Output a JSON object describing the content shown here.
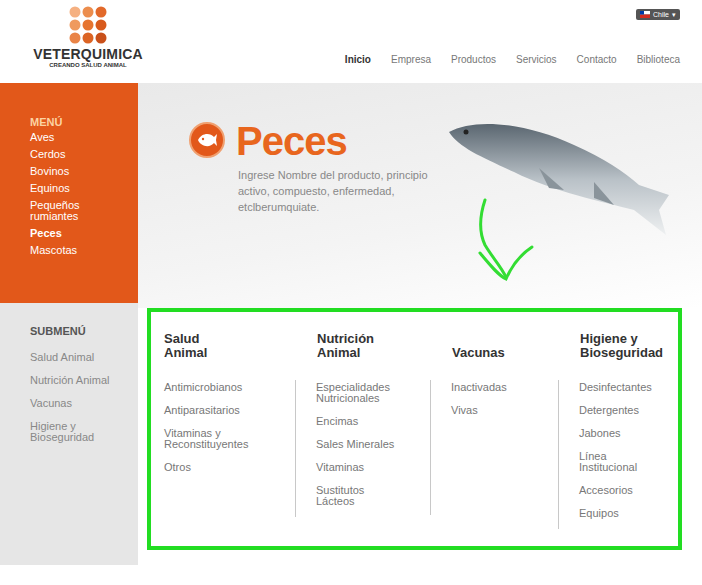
{
  "logo": {
    "name": "VETERQUIMICA",
    "tagline": "CREANDO SALUD ANIMAL"
  },
  "country": {
    "label": "Chile",
    "caret": "▾"
  },
  "nav": [
    {
      "label": "Inicio",
      "selected": true
    },
    {
      "label": "Empresa",
      "selected": false
    },
    {
      "label": "Productos",
      "selected": false
    },
    {
      "label": "Servicios",
      "selected": false
    },
    {
      "label": "Contacto",
      "selected": false
    },
    {
      "label": "Biblioteca",
      "selected": false
    }
  ],
  "menu": {
    "title": "MENÚ",
    "items": [
      {
        "label": "Aves",
        "selected": false
      },
      {
        "label": "Cerdos",
        "selected": false
      },
      {
        "label": "Bovinos",
        "selected": false
      },
      {
        "label": "Equinos",
        "selected": false
      },
      {
        "label": "Pequeños rumiantes",
        "selected": false
      },
      {
        "label": "Peces",
        "selected": true
      },
      {
        "label": "Mascotas",
        "selected": false
      }
    ]
  },
  "submenu": {
    "title": "SUBMENÚ",
    "items": [
      {
        "label": "Salud Animal",
        "selected": false
      },
      {
        "label": "Nutrición Animal",
        "selected": false
      },
      {
        "label": "Vacunas",
        "selected": false
      },
      {
        "label": "Higiene y Bioseguridad",
        "selected": false
      }
    ]
  },
  "hero": {
    "title": "Peces",
    "description": "Ingrese Nombre del producto, principio activo, compuesto, enfermedad, etclberumquiate."
  },
  "categories": [
    {
      "title": "Salud Animal",
      "links": [
        "Antimicrobianos",
        "Antiparasitarios",
        "Vitaminas y Reconstituyentes",
        "Otros"
      ]
    },
    {
      "title": "Nutrición Animal",
      "links": [
        "Especialidades Nutricionales",
        "Encimas",
        "Sales Minerales",
        "Vitaminas",
        "Sustitutos Lácteos"
      ]
    },
    {
      "title": "Vacunas",
      "links": [
        "Inactivadas",
        "Vivas"
      ]
    },
    {
      "title": "Higiene y Bioseguridad",
      "links": [
        "Desinfectantes",
        "Detergentes",
        "Jabones",
        "Línea Institucional",
        "Accesorios",
        "Equipos"
      ]
    }
  ]
}
